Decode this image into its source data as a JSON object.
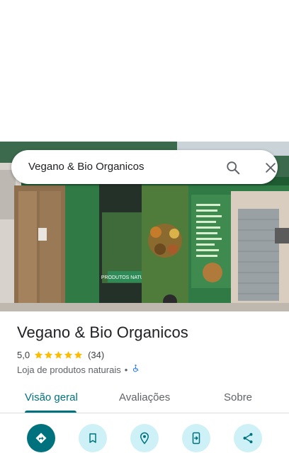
{
  "search": {
    "query": "Vegano & Bio Organicos"
  },
  "place": {
    "name": "Vegano & Bio Organicos",
    "rating": "5,0",
    "stars": 5,
    "review_count": "(34)",
    "category": "Loja de produtos naturais",
    "separator": "•",
    "photo_sign_text": "PRODUTOS NATURAIS"
  },
  "tabs": [
    {
      "label": "Visão geral",
      "active": true
    },
    {
      "label": "Avaliações",
      "active": false
    },
    {
      "label": "Sobre",
      "active": false
    }
  ],
  "actions": [
    {
      "icon": "directions-icon"
    },
    {
      "icon": "bookmark-icon"
    },
    {
      "icon": "nearby-icon"
    },
    {
      "icon": "send-to-phone-icon"
    },
    {
      "icon": "share-icon"
    }
  ],
  "colors": {
    "accent": "#00727d",
    "action_bg": "#cdf1f6",
    "star": "#fbbc04",
    "wall_green": "#2f7a45"
  }
}
